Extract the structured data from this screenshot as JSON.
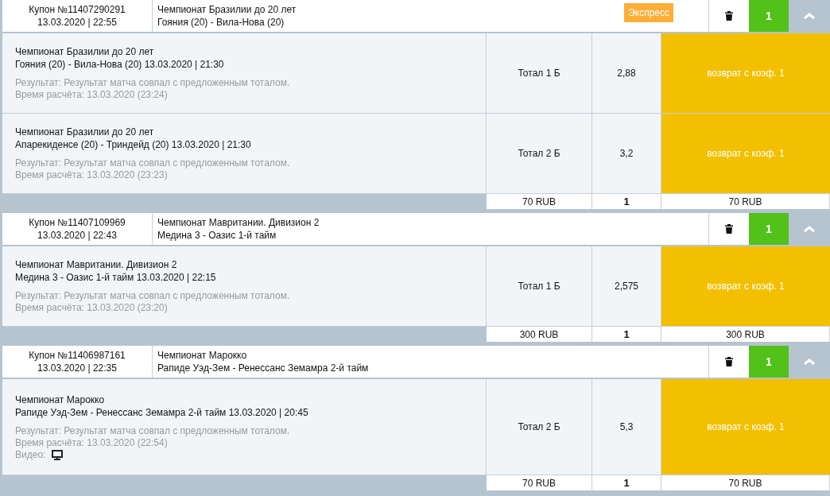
{
  "coupons": [
    {
      "ticket": "Купон №11407290291",
      "datetime": "13.03.2020 | 22:55",
      "event_title": "Чемпионат Бразилии до 20 лет",
      "event_match": "Гояния (20) - Вила-Нова (20)",
      "badge": "Экспресс",
      "count": "1",
      "expanded": true,
      "bets": [
        {
          "championship": "Чемпионат Бразилии до 20 лет",
          "match_line": "Гояния (20) - Вила-Нова (20) 13.03.2020 | 21:30",
          "result": "Результат: Результат матча совпал с предложенным тоталом.",
          "settled_time": "Время расчёта: 13.03.2020 (23:24)",
          "selection": "Тотал 1 Б",
          "odds": "2,88",
          "outcome": "возврат с коэф. 1"
        },
        {
          "championship": "Чемпионат Бразилии до 20 лет",
          "match_line": "Апарекиденсе (20) - Триндейд (20) 13.03.2020 | 21:30",
          "result": "Результат: Результат матча совпал с предложенным тоталом.",
          "settled_time": "Время расчёта: 13.03.2020 (23:23)",
          "selection": "Тотал 2 Б",
          "odds": "3,2",
          "outcome": "возврат с коэф. 1"
        }
      ],
      "footer": {
        "stake": "70 RUB",
        "count": "1",
        "payout": "70 RUB"
      }
    },
    {
      "ticket": "Купон №11407109969",
      "datetime": "13.03.2020 | 22:43",
      "event_title": "Чемпионат Мавритании. Дивизион 2",
      "event_match": "Медина 3 - Оазис 1-й тайм",
      "count": "1",
      "expanded": true,
      "bets": [
        {
          "championship": "Чемпионат Мавритании. Дивизион 2",
          "match_line": "Медина 3 - Оазис 1-й тайм 13.03.2020 | 22:15",
          "result": "Результат: Результат матча совпал с предложенным тоталом.",
          "settled_time": "Время расчёта: 13.03.2020 (23:20)",
          "selection": "Тотал 1 Б",
          "odds": "2,575",
          "outcome": "возврат с коэф. 1"
        }
      ],
      "footer": {
        "stake": "300 RUB",
        "count": "1",
        "payout": "300 RUB"
      }
    },
    {
      "ticket": "Купон №11406987161",
      "datetime": "13.03.2020 | 22:35",
      "event_title": "Чемпионат Марокко",
      "event_match": "Рапиде Уэд-Зем - Ренессанс Земамра 2-й тайм",
      "count": "1",
      "expanded": true,
      "bets": [
        {
          "championship": "Чемпионат Марокко",
          "match_line": "Рапиде Уэд-Зем - Ренессанс Земамра 2-й тайм 13.03.2020 | 20:45",
          "result": "Результат: Результат матча совпал с предложенным тоталом.",
          "settled_time": "Время расчёта: 13.03.2020 (22:54)",
          "video_label": "Видео:",
          "selection": "Тотал 2 Б",
          "odds": "5,3",
          "outcome": "возврат с коэф. 1"
        }
      ],
      "footer": {
        "stake": "70 RUB",
        "count": "1",
        "payout": "70 RUB"
      }
    }
  ]
}
